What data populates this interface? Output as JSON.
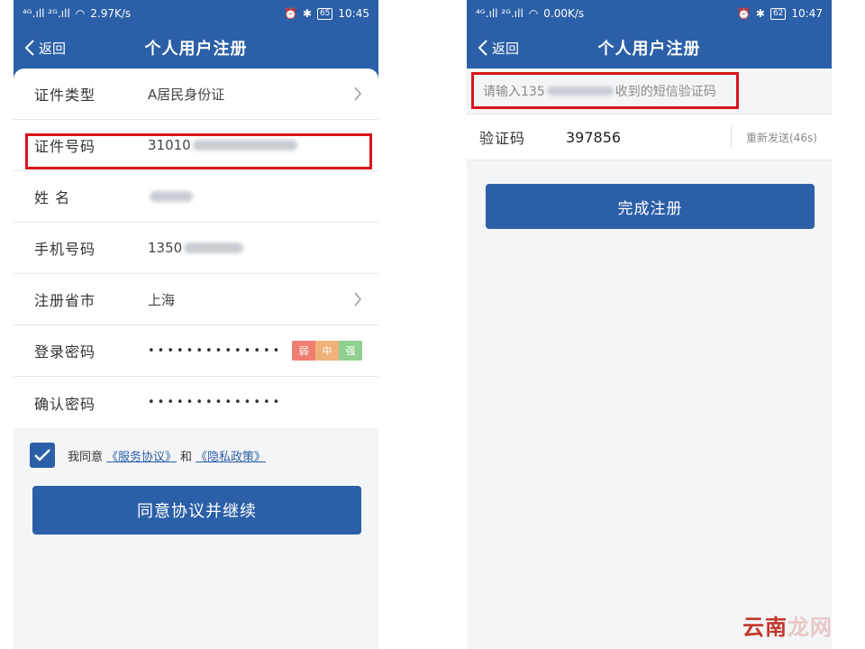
{
  "left": {
    "status": {
      "signal": "⁴ᴳ.ıll ²ᴳ.ıll",
      "speed": "2.97K/s",
      "battery": "65",
      "time": "10:45"
    },
    "nav": {
      "back_label": "返回",
      "title": "个人用户注册"
    },
    "form": {
      "id_type": {
        "label": "证件类型",
        "value": "A居民身份证"
      },
      "id_number": {
        "label": "证件号码",
        "value": "31010"
      },
      "name": {
        "label": "姓 名"
      },
      "phone": {
        "label": "手机号码",
        "value": "1350"
      },
      "province": {
        "label": "注册省市",
        "value": "上海"
      },
      "password": {
        "label": "登录密码",
        "value": "••••••••••••••"
      },
      "confirm_password": {
        "label": "确认密码",
        "value": "••••••••••••••"
      },
      "strength": {
        "weak": "弱",
        "medium": "中",
        "strong": "强"
      }
    },
    "agree": {
      "prefix": "我同意",
      "service": "《服务协议》",
      "and": "和",
      "privacy": "《隐私政策》"
    },
    "continue_button": "同意协议并继续"
  },
  "right": {
    "status": {
      "signal": "⁴ᴳ.ıll ²ᴳ.ıll",
      "speed": "0.00K/s",
      "battery": "62",
      "time": "10:47"
    },
    "nav": {
      "back_label": "返回",
      "title": "个人用户注册"
    },
    "hint_prefix": "请输入135",
    "hint_suffix": "收到的短信验证码",
    "code_label": "验证码",
    "code_value": "397856",
    "resend": "重新发送(46s)",
    "finish_button": "完成注册"
  },
  "watermark": {
    "red": "云南",
    "rest": "龙网"
  },
  "colors": {
    "primary": "#2b5fa7",
    "highlight": "#d8141b"
  }
}
